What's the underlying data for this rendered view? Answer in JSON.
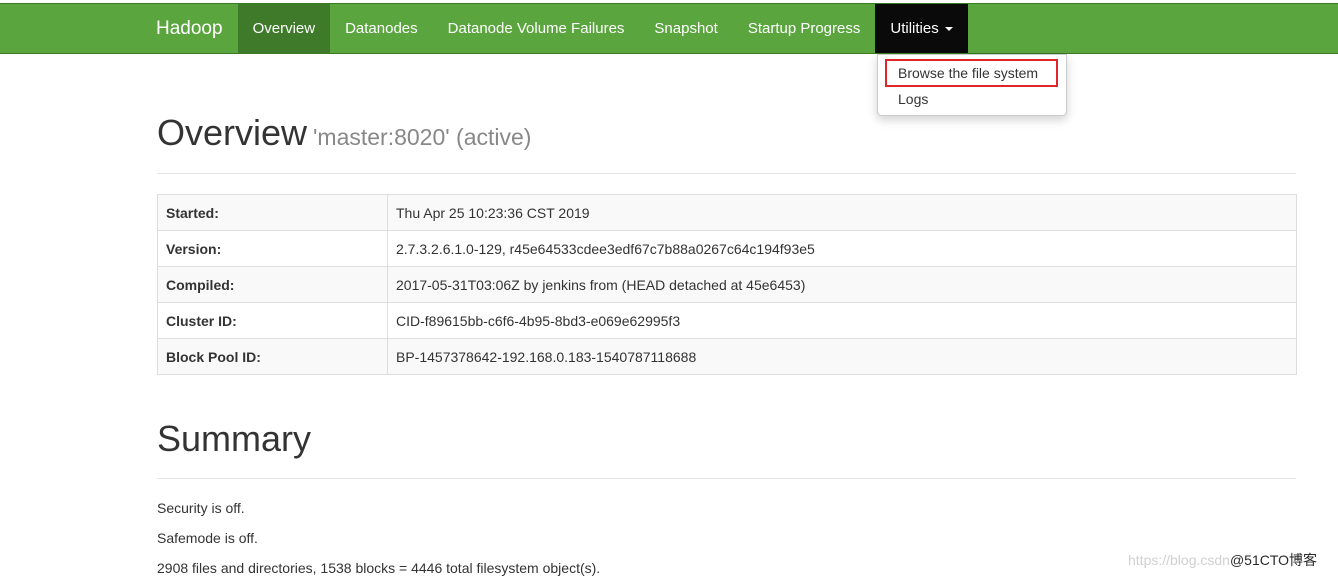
{
  "navbar": {
    "brand": "Hadoop",
    "items": [
      "Overview",
      "Datanodes",
      "Datanode Volume Failures",
      "Snapshot",
      "Startup Progress",
      "Utilities"
    ],
    "active": "Overview"
  },
  "dropdown": {
    "items": [
      "Browse the file system",
      "Logs"
    ],
    "highlighted": "Browse the file system",
    "highlight_color": "#e0262a"
  },
  "overview": {
    "title": "Overview",
    "subtitle": "'master:8020' (active)",
    "rows": [
      {
        "label": "Started:",
        "value": "Thu Apr 25 10:23:36 CST 2019"
      },
      {
        "label": "Version:",
        "value": "2.7.3.2.6.1.0-129, r45e64533cdee3edf67c7b88a0267c64c194f93e5"
      },
      {
        "label": "Compiled:",
        "value": "2017-05-31T03:06Z by jenkins from (HEAD detached at 45e6453)"
      },
      {
        "label": "Cluster ID:",
        "value": "CID-f89615bb-c6f6-4b95-8bd3-e069e62995f3"
      },
      {
        "label": "Block Pool ID:",
        "value": "BP-1457378642-192.168.0.183-1540787118688"
      }
    ]
  },
  "summary": {
    "title": "Summary",
    "lines": [
      "Security is off.",
      "Safemode is off.",
      "2908 files and directories, 1538 blocks = 4446 total filesystem object(s)."
    ]
  },
  "watermark": {
    "url": "https://blog.csdn",
    "brand": "@51CTO博客"
  },
  "colors": {
    "navbar": "#5ba53f",
    "nav_active": "#3f7a2a",
    "nav_open": "#0a0a0a"
  }
}
